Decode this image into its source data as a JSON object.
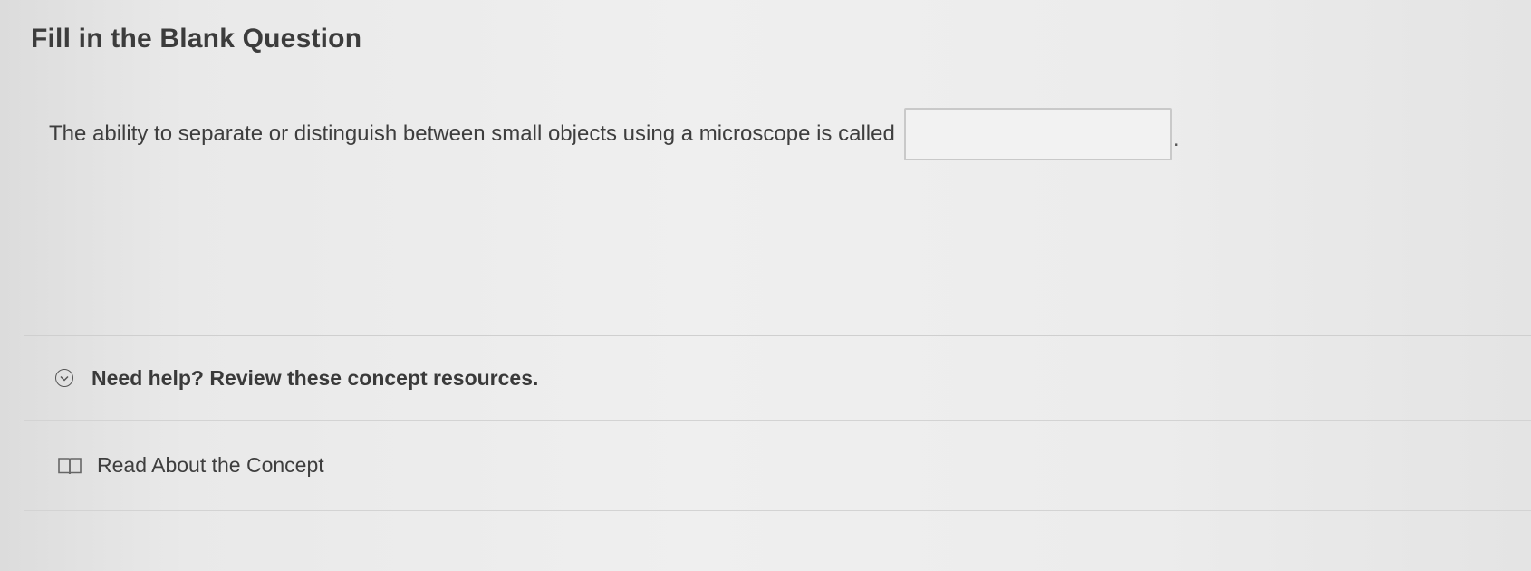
{
  "question": {
    "title": "Fill in the Blank Question",
    "prompt": "The ability to separate or distinguish between small objects using a microscope is called",
    "blank_value": "",
    "after_blank": "."
  },
  "help": {
    "toggle_icon": "chevron-down-circle-icon",
    "title": "Need help? Review these concept resources.",
    "resources": [
      {
        "icon": "book-icon",
        "label": "Read About the Concept"
      }
    ]
  }
}
